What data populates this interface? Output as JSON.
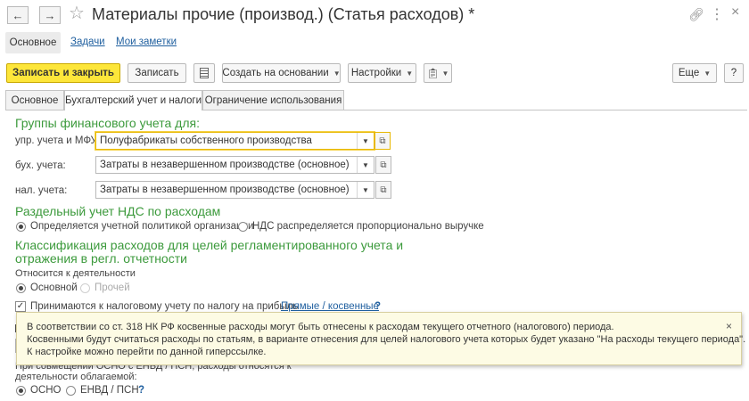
{
  "window": {
    "title": "Материалы прочие (производ.) (Статья расходов) *"
  },
  "nav": {
    "main": "Основное",
    "tasks": "Задачи",
    "notes": "Мои заметки"
  },
  "toolbar": {
    "save_close": "Записать и закрыть",
    "save": "Записать",
    "create_based": "Создать на основании",
    "settings": "Настройки",
    "more": "Еще",
    "help": "?"
  },
  "tabs": [
    {
      "label": "Основное",
      "active": false
    },
    {
      "label": "Бухгалтерский учет и налоги",
      "active": true
    },
    {
      "label": "Ограничение использования",
      "active": false
    }
  ],
  "groups": {
    "heading": "Группы финансового учета для:",
    "fields": [
      {
        "label": "упр. учета и МФУ:",
        "value": "Полуфабрикаты собственного производства"
      },
      {
        "label": "бух. учета:",
        "value": "Затраты в незавершенном производстве (основное)"
      },
      {
        "label": "нал. учета:",
        "value": "Затраты в незавершенном производстве (основное)"
      }
    ]
  },
  "vat": {
    "heading": "Раздельный учет НДС по расходам",
    "option1": "Определяется учетной политикой организации",
    "option2": "НДС распределяется пропорционально выручке"
  },
  "classification": {
    "heading_line1": "Классификация расходов для целей регламентированного учета и",
    "heading_line2": "отражения в регл. отчетности",
    "activity_label": "Относится к деятельности",
    "option_main": "Основной",
    "option_other": "Прочей",
    "tax_check": "Принимаются к налоговому учету по налогу на прибыль",
    "direct_link": "Прямые / косвенные",
    "help": "?"
  },
  "tooltip": {
    "line1": "В соответствии со ст. 318 НК РФ косвенные расходы могут быть отнесены к расходам текущего отчетного (налогового) периода.",
    "line2": "Косвенными будут считаться расходы по статьям, в варианте отнесения для целей налогового учета которых будет указано \"На расходы текущего периода\".",
    "line3": "К настройке можно перейти по данной гиперссылке.",
    "close": "×"
  },
  "combined": {
    "line1": "При совмещении ОСНО с ЕНВД / ПСН, расходы относятся к",
    "line2": "деятельности облагаемой:",
    "option1": "ОСНО",
    "option2": "ЕНВД / ПСН",
    "help": "?"
  }
}
